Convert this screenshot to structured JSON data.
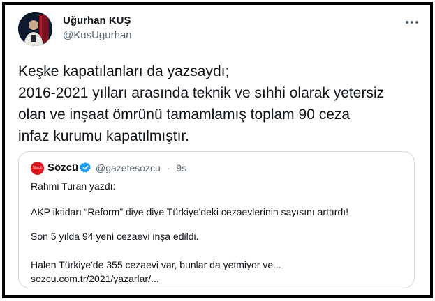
{
  "tweet": {
    "author_name": "Uğurhan KUŞ",
    "author_handle": "@KusUgurhan",
    "more_icon": "more-dots-icon",
    "text_lines": [
      "Keşke kapatılanları da yazsaydı;",
      "2016-2021 yılları arasında teknik ve sıhhi olarak yetersiz",
      "olan ve inşaat ömrünü tamamlamış toplam 90 ceza",
      "infaz kurumu kapatılmıştır."
    ]
  },
  "quote": {
    "logo_text": "Sözcü",
    "author_name": "Sözcü",
    "verified_icon": "verified-badge-icon",
    "author_handle": "@gazetesozcu",
    "separator": "·",
    "time": "9s",
    "lines": [
      "Rahmi Turan yazdı:",
      "AKP iktidarı “Reform” diye diye Türkiye'deki cezaevlerinin sayısını arttırdı!",
      "Son 5 yılda 94 yeni cezaevi inşa edildi.",
      "Halen Türkiye'de 355 cezaevi var, bunlar da yetmiyor ve...",
      "sozcu.com.tr/2021/yazarlar/..."
    ]
  },
  "colors": {
    "text": "#0f1419",
    "secondary": "#536471",
    "verified": "#1d9bf0",
    "border": "#cfd9de",
    "brand_red": "#e0141e"
  }
}
